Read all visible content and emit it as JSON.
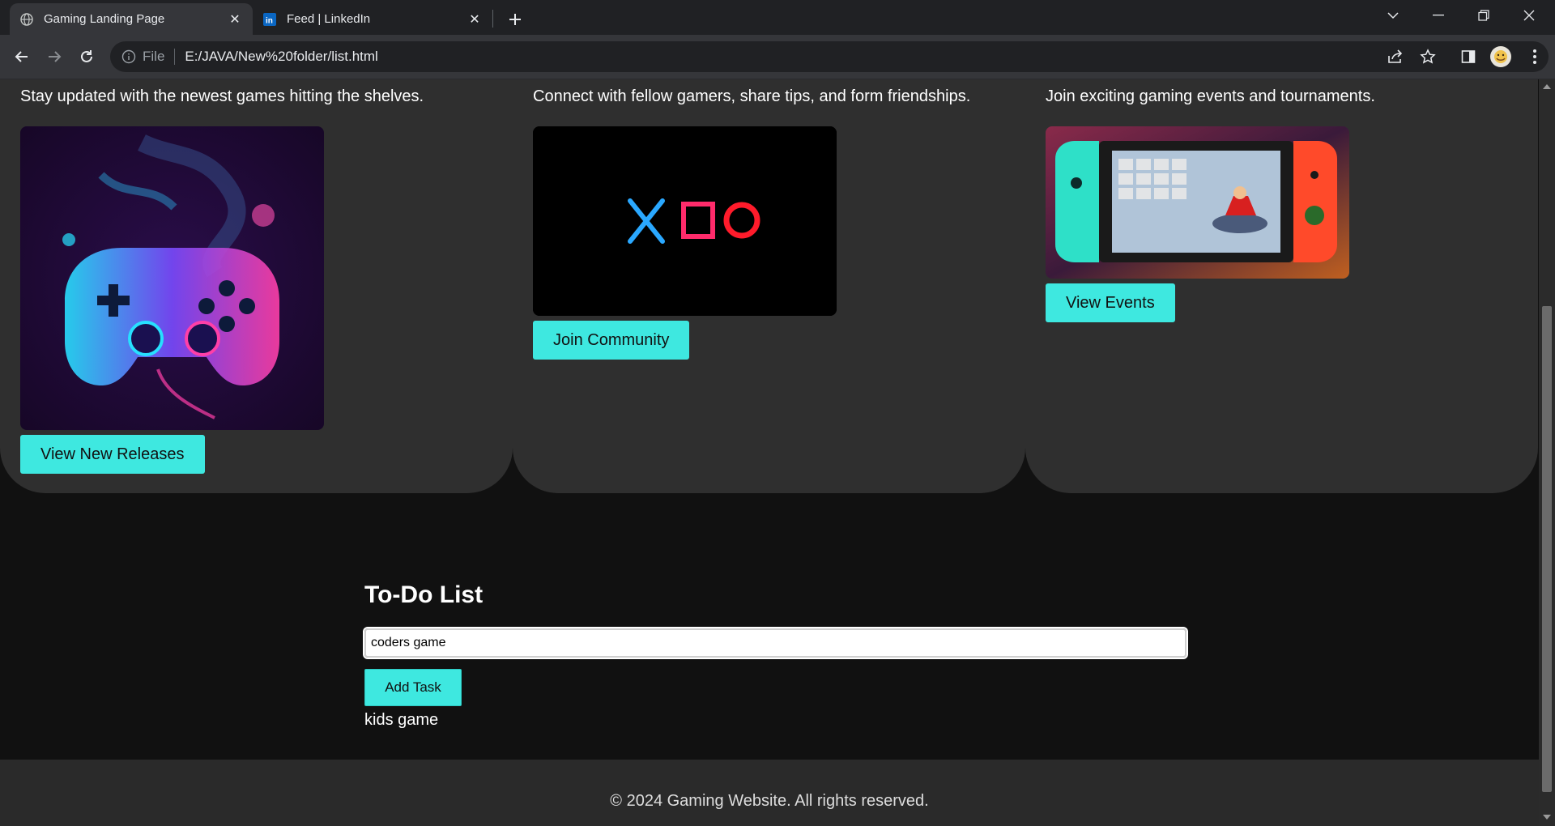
{
  "browser": {
    "tabs": [
      {
        "title": "Gaming Landing Page",
        "favicon": "globe-icon",
        "active": true
      },
      {
        "title": "Feed | LinkedIn",
        "favicon": "linkedin-icon",
        "active": false
      }
    ],
    "address": {
      "scheme_label": "File",
      "url": "E:/JAVA/New%20folder/list.html"
    }
  },
  "page": {
    "cards": [
      {
        "text": "Stay updated with the newest games hitting the shelves.",
        "image": "neon-gamepad-illustration",
        "button": "View New Releases"
      },
      {
        "text": "Connect with fellow gamers, share tips, and form friendships.",
        "image": "playstation-symbols",
        "button": "Join Community"
      },
      {
        "text": "Join exciting gaming events and tournaments.",
        "image": "nintendo-switch-mario-kart",
        "button": "View Events"
      }
    ],
    "todo": {
      "title": "To-Do List",
      "input_value": "coders game",
      "add_button": "Add Task",
      "items": [
        "kids game"
      ]
    },
    "footer": "© 2024 Gaming Website. All rights reserved."
  },
  "colors": {
    "accent": "#3ee8e0",
    "card_bg": "#2f2f2f",
    "page_bg": "#111111",
    "footer_bg": "#2a2a2a"
  }
}
